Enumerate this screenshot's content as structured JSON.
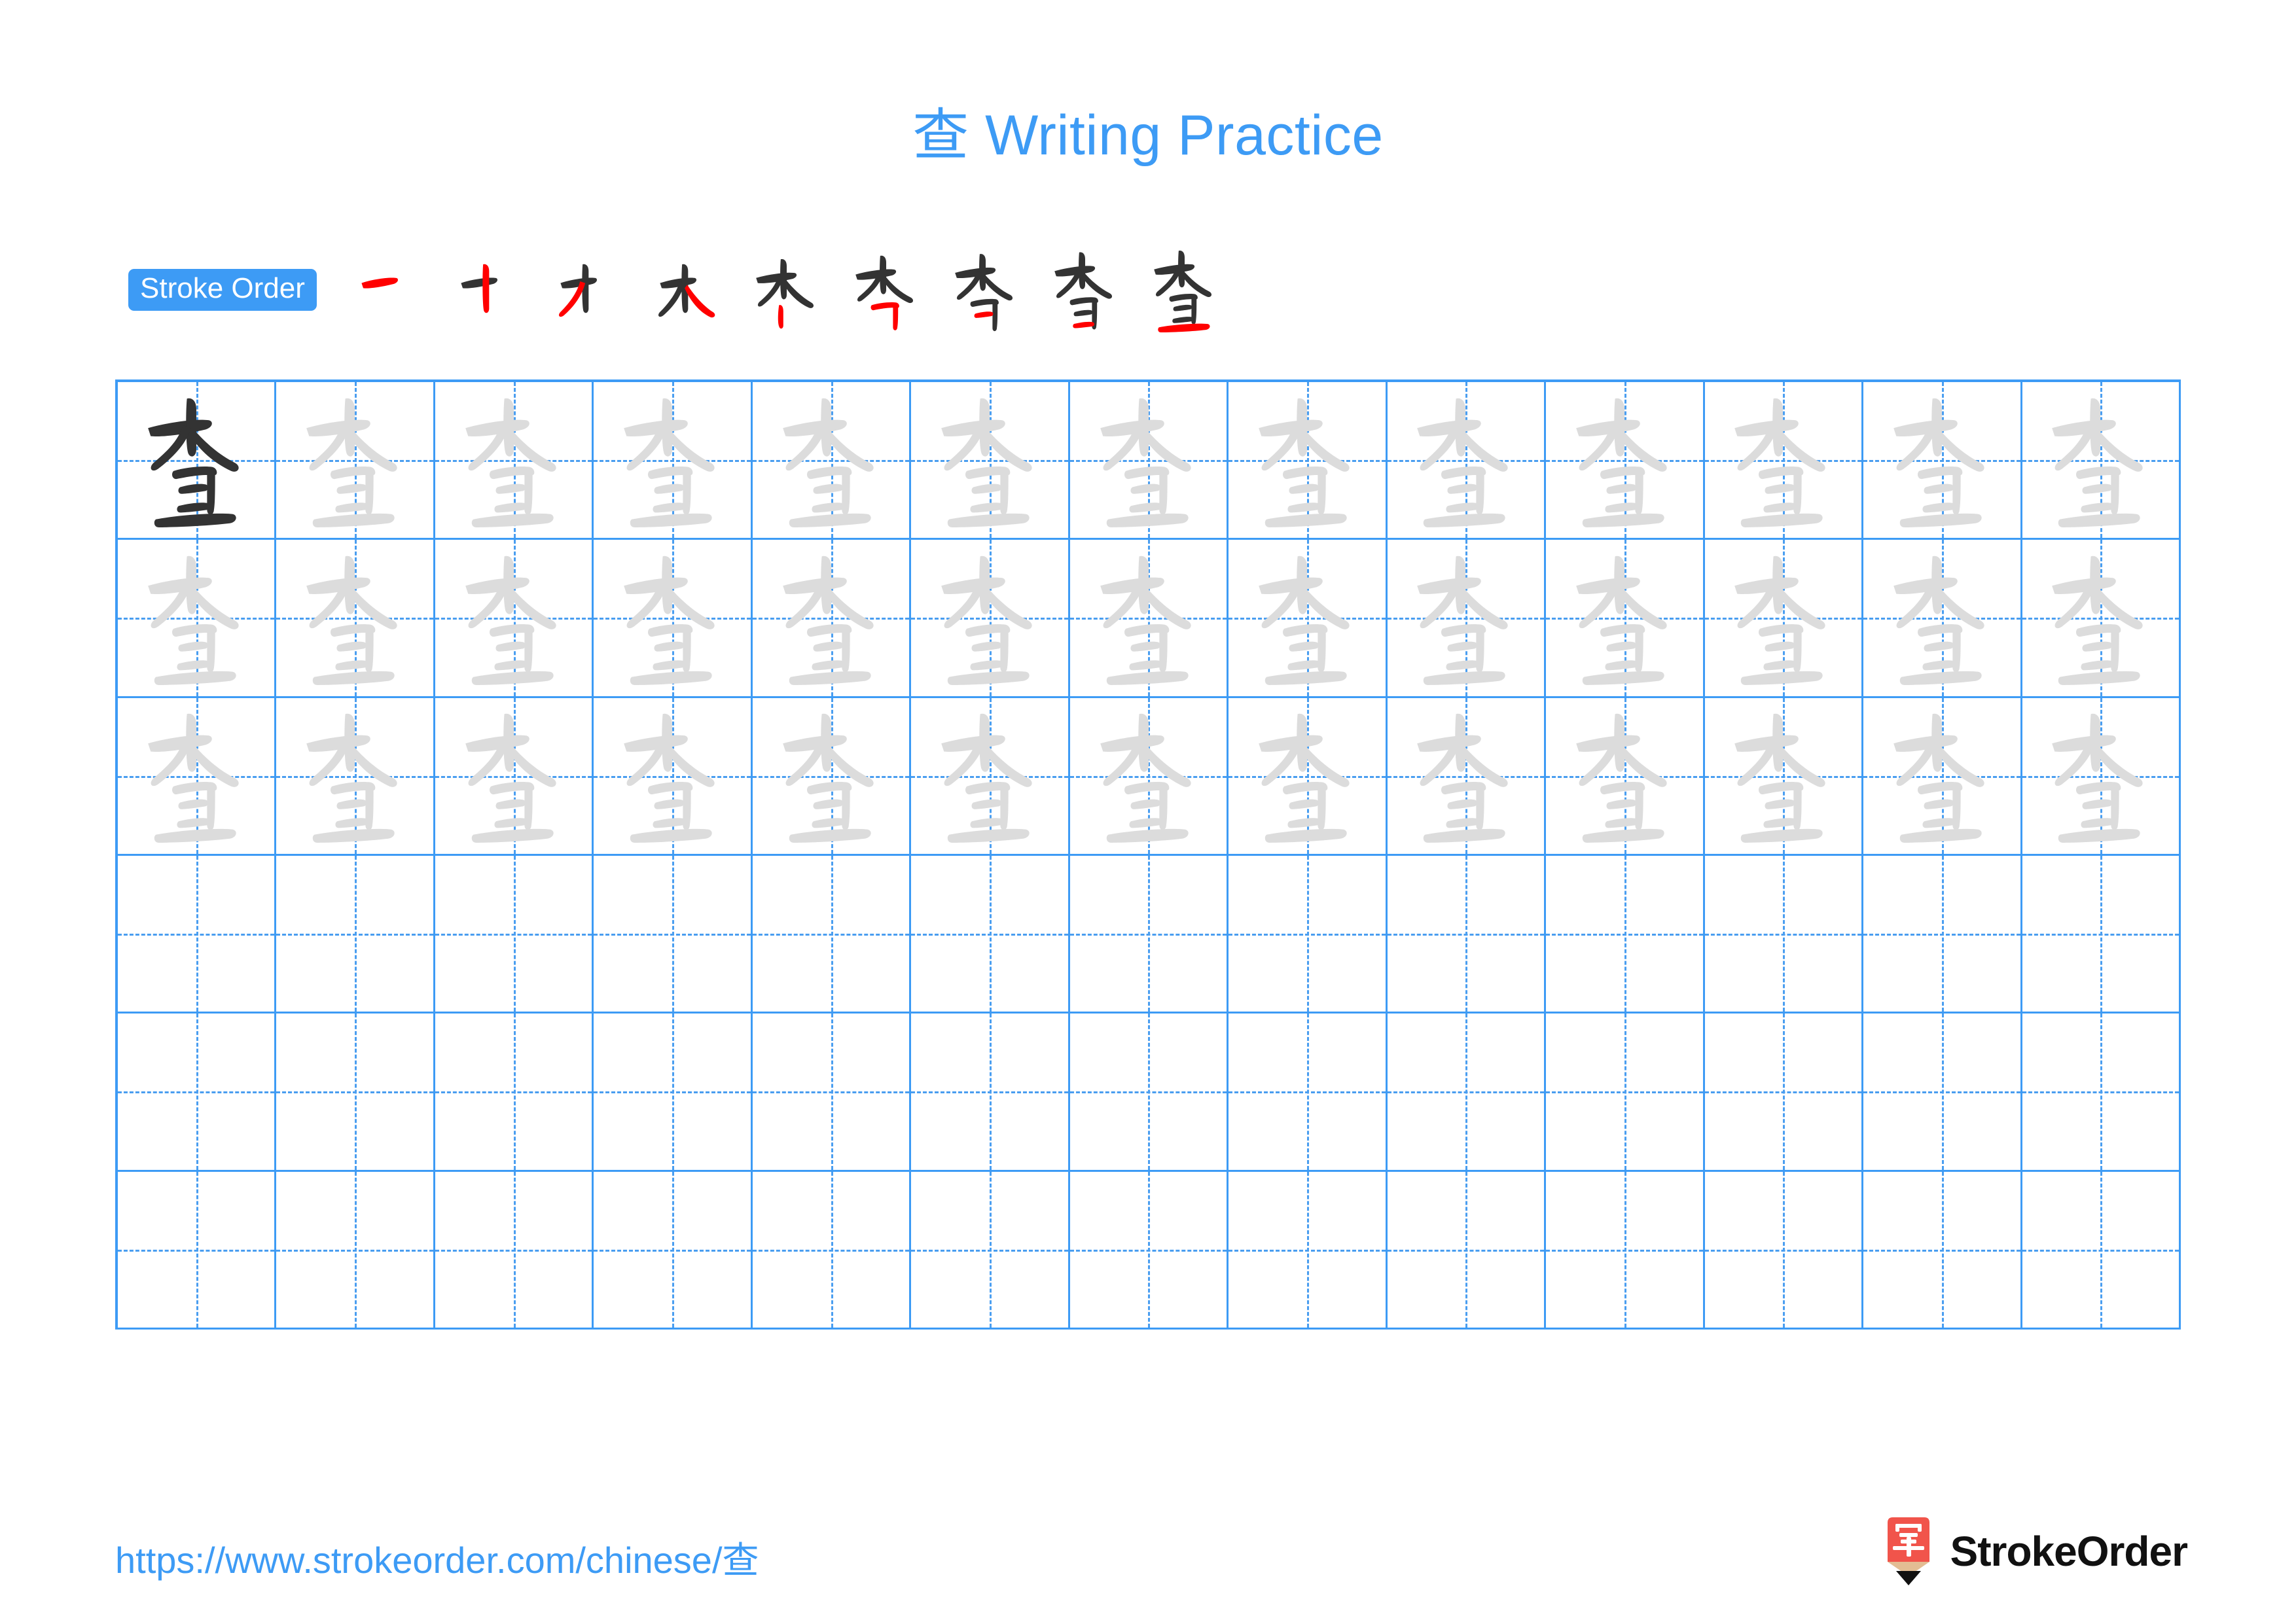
{
  "page": {
    "character": "查",
    "title_prefix": "查",
    "title_text": " Writing Practice",
    "title_full": "查 Writing Practice",
    "accent_blue": "#3d9bf5",
    "grid_line_blue": "#4a9ef0",
    "trace_gray": "#dcdcdc",
    "ink_dark": "#333333",
    "stroke_highlight_red": "#ff0000",
    "logo_red": "#f1544b",
    "logo_wood": "#e3bd93"
  },
  "stroke_order": {
    "badge_label": "Stroke Order",
    "total_strokes": 9,
    "steps": [
      {
        "index": 1,
        "partial": "一",
        "new_stroke": "héng (horizontal)"
      },
      {
        "index": 2,
        "partial": "十",
        "new_stroke": "shù (vertical)"
      },
      {
        "index": 3,
        "partial": "才",
        "new_stroke": "piě (left-falling)"
      },
      {
        "index": 4,
        "partial": "木",
        "new_stroke": "nà (right-falling)"
      },
      {
        "index": 5,
        "partial": "朩",
        "new_stroke": "shù (vertical)"
      },
      {
        "index": 6,
        "partial": "杏",
        "new_stroke": "héngzhé (horizontal-turn)"
      },
      {
        "index": 7,
        "partial": "杳",
        "new_stroke": "héng (horizontal)"
      },
      {
        "index": 8,
        "partial": "杳",
        "new_stroke": "héng (horizontal)"
      },
      {
        "index": 9,
        "partial": "查",
        "new_stroke": "héng (bottom horizontal)"
      }
    ]
  },
  "practice_grid": {
    "columns": 13,
    "rows": 6,
    "cells": [
      [
        "dark",
        "light",
        "light",
        "light",
        "light",
        "light",
        "light",
        "light",
        "light",
        "light",
        "light",
        "light",
        "light"
      ],
      [
        "light",
        "light",
        "light",
        "light",
        "light",
        "light",
        "light",
        "light",
        "light",
        "light",
        "light",
        "light",
        "light"
      ],
      [
        "light",
        "light",
        "light",
        "light",
        "light",
        "light",
        "light",
        "light",
        "light",
        "light",
        "light",
        "light",
        "light"
      ],
      [
        "empty",
        "empty",
        "empty",
        "empty",
        "empty",
        "empty",
        "empty",
        "empty",
        "empty",
        "empty",
        "empty",
        "empty",
        "empty"
      ],
      [
        "empty",
        "empty",
        "empty",
        "empty",
        "empty",
        "empty",
        "empty",
        "empty",
        "empty",
        "empty",
        "empty",
        "empty",
        "empty"
      ],
      [
        "empty",
        "empty",
        "empty",
        "empty",
        "empty",
        "empty",
        "empty",
        "empty",
        "empty",
        "empty",
        "empty",
        "empty",
        "empty"
      ]
    ]
  },
  "footer": {
    "url_prefix": "https://www.strokeorder.com/chinese/",
    "url_character": "查",
    "url_full": "https://www.strokeorder.com/chinese/查",
    "brand_name": "StrokeOrder",
    "brand_mark_character": "字"
  }
}
